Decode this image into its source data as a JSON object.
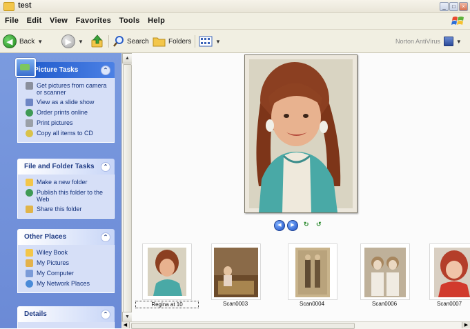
{
  "window": {
    "title": "test",
    "controls": [
      "minimize",
      "maximize",
      "close"
    ]
  },
  "menu": [
    "File",
    "Edit",
    "View",
    "Favorites",
    "Tools",
    "Help"
  ],
  "toolbar": {
    "back_label": "Back",
    "search_label": "Search",
    "folders_label": "Folders",
    "norton_label": "Norton AntiVirus"
  },
  "tasks": {
    "picture": {
      "title": "Picture Tasks",
      "items": [
        "Get pictures from camera or scanner",
        "View as a slide show",
        "Order prints online",
        "Print pictures",
        "Copy all items to CD"
      ]
    },
    "file": {
      "title": "File and Folder Tasks",
      "items": [
        "Make a new folder",
        "Publish this folder to the Web",
        "Share this folder"
      ]
    },
    "other": {
      "title": "Other Places",
      "items": [
        "Wiley Book",
        "My Pictures",
        "My Computer",
        "My Network Places"
      ]
    },
    "details": {
      "title": "Details"
    }
  },
  "thumbnails": [
    {
      "label": "Regina at 10",
      "selected": true
    },
    {
      "label": "Scan0003",
      "selected": false
    },
    {
      "label": "Scan0004",
      "selected": false
    },
    {
      "label": "Scan0006",
      "selected": false
    },
    {
      "label": "Scan0007",
      "selected": false
    }
  ],
  "colors": {
    "taskpane_bg": "#7b9bdf",
    "panel_header_blue": "#1c57c9",
    "panel_body": "#d6dff7",
    "link_text": "#12307a"
  }
}
